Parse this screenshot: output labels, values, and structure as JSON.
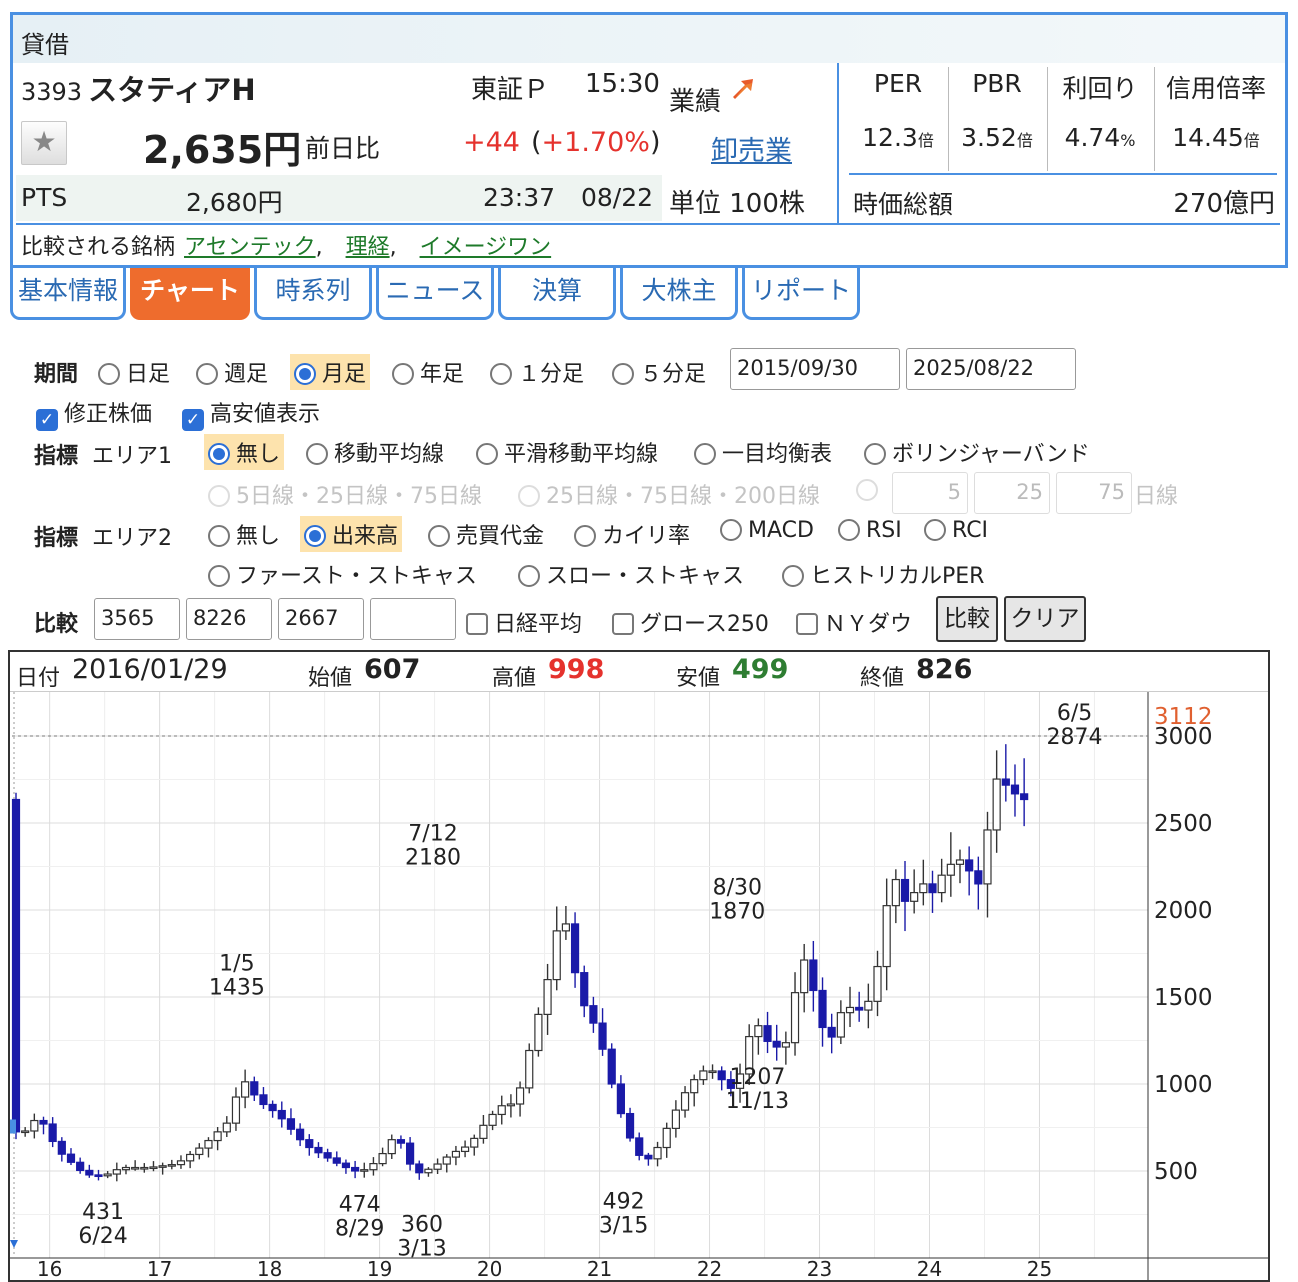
{
  "header": {
    "title": "貸借",
    "code": "3393",
    "name": "スタティアH",
    "market": "東証Ｐ",
    "time": "15:30",
    "price": "2,635円",
    "prev_label": "前日比",
    "change": "+44",
    "change_pct": "+1.70%",
    "pts_label": "PTS",
    "pts_price": "2,680円",
    "pts_time": "23:37",
    "pts_date": "08/22",
    "perf_label": "業績",
    "sector": "卸売業",
    "unit": "単位 100株",
    "compare_label": "比較される銘柄",
    "compare_links": [
      "アセンテック",
      "理経",
      "イメージワン"
    ],
    "separator": ",",
    "star_icon": "★"
  },
  "metrics": [
    {
      "label": "PER",
      "value": "12.3",
      "unit": "倍"
    },
    {
      "label": "PBR",
      "value": "3.52",
      "unit": "倍"
    },
    {
      "label": "利回り",
      "value": "4.74",
      "unit": "%"
    },
    {
      "label": "信用倍率",
      "value": "14.45",
      "unit": "倍"
    }
  ],
  "market_cap": {
    "label": "時価総額",
    "value": "270億円"
  },
  "tabs": [
    "基本情報",
    "チャート",
    "時系列",
    "ニュース",
    "決算",
    "大株主",
    "リポート"
  ],
  "active_tab": "チャート",
  "controls": {
    "period_label": "期間",
    "period_options": [
      "日足",
      "週足",
      "月足",
      "年足",
      "１分足",
      "５分足"
    ],
    "period_selected": "月足",
    "date_from": "2015/09/30",
    "date_to": "2025/08/22",
    "adjusted_label": "修正株価",
    "highlow_label": "高安値表示",
    "indicator_label": "指標",
    "area1_label": "エリア1",
    "area1_options": [
      "無し",
      "移動平均線",
      "平滑移動平均線",
      "一目均衡表",
      "ボリンジャーバンド"
    ],
    "area1_selected": "無し",
    "ma_options": [
      "5日線・25日線・75日線",
      "25日線・75日線・200日線"
    ],
    "ma_inputs": [
      "5",
      "25",
      "75"
    ],
    "ma_suffix": "日線",
    "area2_label": "エリア2",
    "area2_options": [
      "無し",
      "出来高",
      "売買代金",
      "カイリ率",
      "MACD",
      "RSI",
      "RCI"
    ],
    "area2_options_row2": [
      "ファースト・ストキャス",
      "スロー・ストキャス",
      "ヒストリカルPER"
    ],
    "area2_selected": "出来高",
    "compare_label": "比較",
    "compare_inputs": [
      "3565",
      "8226",
      "2667",
      ""
    ],
    "compare_checks": [
      "日経平均",
      "グロース250",
      "ＮＹダウ"
    ],
    "compare_button": "比較",
    "clear_button": "クリア"
  },
  "chart_info": {
    "date_label": "日付",
    "date": "2016/01/29",
    "open_label": "始値",
    "open": "607",
    "high_label": "高値",
    "high": "998",
    "low_label": "安値",
    "low": "499",
    "close_label": "終値",
    "close": "826"
  },
  "colors": {
    "up_candle": "#ffffff",
    "down_candle": "#1a1aa8",
    "high_value": "#e5322d",
    "low_value": "#2e7d32",
    "accent": "#4a90e2",
    "active_tab": "#ee6c2d",
    "max_label": "#e06030"
  },
  "chart_data": {
    "type": "candlestick",
    "interval": "monthly",
    "x_axis_labels": [
      "16",
      "17",
      "18",
      "19",
      "20",
      "21",
      "22",
      "23",
      "24",
      "25"
    ],
    "y_ticks": [
      500,
      1000,
      1500,
      2000,
      2500,
      3000
    ],
    "ylim": [
      0,
      3112
    ],
    "max_marker": "3112",
    "annotations": [
      {
        "date": "1/5",
        "value": "1435",
        "time": 24.1
      },
      {
        "date": "7/12",
        "value": "2180",
        "time": 45.5
      },
      {
        "date": "8/30",
        "value": "1870",
        "time": 78.7
      },
      {
        "date": "6/5",
        "value": "2874",
        "time": 115.5
      },
      {
        "date": "6/24",
        "value": "431",
        "time": 9.5
      },
      {
        "date": "8/29",
        "value": "474",
        "time": 37.5
      },
      {
        "date": "3/13",
        "value": "360",
        "time": 44.3
      },
      {
        "date": "3/15",
        "value": "492",
        "time": 66.3
      },
      {
        "date": "11/13",
        "value": "1207",
        "time": 80.9
      }
    ],
    "anchors": [
      [
        0,
        750
      ],
      [
        1,
        700
      ],
      [
        3,
        820
      ],
      [
        5,
        620
      ],
      [
        8,
        480
      ],
      [
        10,
        470
      ],
      [
        12,
        520
      ],
      [
        15,
        520
      ],
      [
        18,
        540
      ],
      [
        21,
        650
      ],
      [
        24,
        800
      ],
      [
        25,
        1050
      ],
      [
        27,
        900
      ],
      [
        29,
        830
      ],
      [
        32,
        650
      ],
      [
        36,
        530
      ],
      [
        38,
        490
      ],
      [
        40,
        560
      ],
      [
        42,
        720
      ],
      [
        43,
        600
      ],
      [
        44,
        480
      ],
      [
        46,
        520
      ],
      [
        48,
        600
      ],
      [
        50,
        650
      ],
      [
        52,
        800
      ],
      [
        54,
        900
      ],
      [
        55,
        870
      ],
      [
        57,
        1300
      ],
      [
        59,
        1700
      ],
      [
        60,
        2060
      ],
      [
        62,
        1500
      ],
      [
        64,
        1300
      ],
      [
        66,
        900
      ],
      [
        68,
        620
      ],
      [
        69,
        560
      ],
      [
        70,
        580
      ],
      [
        72,
        800
      ],
      [
        74,
        1000
      ],
      [
        76,
        1100
      ],
      [
        77,
        1050
      ],
      [
        79,
        950
      ],
      [
        81,
        1380
      ],
      [
        83,
        1200
      ],
      [
        85,
        1250
      ],
      [
        86,
        1800
      ],
      [
        88,
        1450
      ],
      [
        89,
        1200
      ],
      [
        91,
        1480
      ],
      [
        92,
        1400
      ],
      [
        94,
        1500
      ],
      [
        96,
        2200
      ],
      [
        97,
        2150
      ],
      [
        98,
        1950
      ],
      [
        99,
        2250
      ],
      [
        100,
        2050
      ],
      [
        102,
        2250
      ],
      [
        104,
        2300
      ],
      [
        105,
        2150
      ],
      [
        106,
        2150
      ],
      [
        107,
        2770
      ],
      [
        109,
        2700
      ],
      [
        110,
        2635
      ]
    ]
  }
}
